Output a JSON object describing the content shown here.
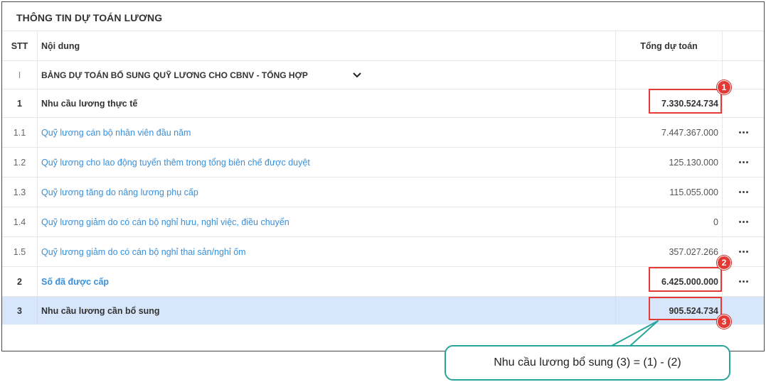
{
  "panel": {
    "title": "THÔNG TIN DỰ TOÁN LƯƠNG"
  },
  "header": {
    "stt": "STT",
    "content": "Nội dung",
    "total": "Tổng dự toán"
  },
  "rows": [
    {
      "stt": "I",
      "content": "BẢNG DỰ TOÁN BỔ SUNG QUỸ LƯƠNG CHO CBNV - TỔNG HỢP",
      "total": ""
    },
    {
      "stt": "1",
      "content": "Nhu cầu lương thực tế",
      "total": "7.330.524.734"
    },
    {
      "stt": "1.1",
      "content": "Quỹ lương cán bộ nhân viên đầu năm",
      "total": "7.447.367.000"
    },
    {
      "stt": "1.2",
      "content": "Quỹ lương cho lao động tuyển thêm trong tổng biên chế được duyệt",
      "total": "125.130.000"
    },
    {
      "stt": "1.3",
      "content": "Quỹ lương tăng do nâng lương phụ cấp",
      "total": "115.055.000"
    },
    {
      "stt": "1.4",
      "content": "Quỹ lương giảm do có cán bộ nghỉ hưu, nghỉ việc, điều chuyển",
      "total": "0"
    },
    {
      "stt": "1.5",
      "content": "Quỹ lương giảm do có cán bộ nghỉ thai sản/nghỉ ốm",
      "total": "357.027.266"
    },
    {
      "stt": "2",
      "content": "Số đã được cấp",
      "total": "6.425.000.000"
    },
    {
      "stt": "3",
      "content": "Nhu cầu lương cần bổ sung",
      "total": "905.524.734"
    }
  ],
  "annotations": {
    "badges": [
      "1",
      "2",
      "3"
    ],
    "callout": "Nhu cầu lương bổ sung (3) = (1) - (2)"
  },
  "colors": {
    "highlight": "#e53935",
    "link": "#3a8fd9",
    "selected_row": "#d7e6fb",
    "callout_border": "#26a69a"
  },
  "icons": {
    "section_toggle": "chevron-down-icon",
    "row_action": "more-horizontal-icon"
  }
}
